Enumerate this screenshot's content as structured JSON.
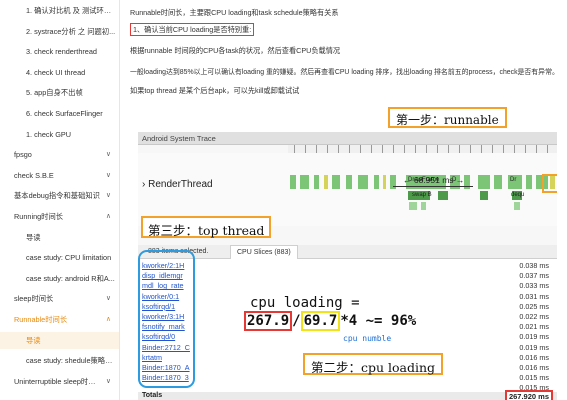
{
  "sidebar": {
    "items": [
      {
        "label": "1. 确认对比机 及 测试环境...",
        "indent": 2,
        "chevron": "",
        "state": "normal"
      },
      {
        "label": "2. systrace分析 之 问题初...",
        "indent": 2,
        "chevron": "",
        "state": "normal"
      },
      {
        "label": "3. check renderthread",
        "indent": 2,
        "chevron": "",
        "state": "normal"
      },
      {
        "label": "4. check UI thread",
        "indent": 2,
        "chevron": "",
        "state": "normal"
      },
      {
        "label": "5. app自身不出帧",
        "indent": 2,
        "chevron": "",
        "state": "normal"
      },
      {
        "label": "6. check SurfaceFlinger",
        "indent": 2,
        "chevron": "",
        "state": "normal"
      },
      {
        "label": "1. check GPU",
        "indent": 2,
        "chevron": "",
        "state": "normal"
      },
      {
        "label": "fpsgo",
        "indent": 0,
        "chevron": "∨",
        "state": "normal"
      },
      {
        "label": "check S.B.E",
        "indent": 0,
        "chevron": "∨",
        "state": "normal"
      },
      {
        "label": "基本debug指令和基础知识",
        "indent": 0,
        "chevron": "∨",
        "state": "normal"
      },
      {
        "label": "Running时间长",
        "indent": 0,
        "chevron": "∧",
        "state": "normal"
      },
      {
        "label": "导读",
        "indent": 1,
        "chevron": "",
        "state": "normal"
      },
      {
        "label": "case study: CPU limitation",
        "indent": 1,
        "chevron": "",
        "state": "normal"
      },
      {
        "label": "case study: android R和A...",
        "indent": 1,
        "chevron": "",
        "state": "normal"
      },
      {
        "label": "sleep时间长",
        "indent": 0,
        "chevron": "∨",
        "state": "normal"
      },
      {
        "label": "Runnable时间长",
        "indent": 0,
        "chevron": "∧",
        "state": "accent"
      },
      {
        "label": "导读",
        "indent": 1,
        "chevron": "",
        "state": "selected"
      },
      {
        "label": "case study: shedule策略导...",
        "indent": 1,
        "chevron": "",
        "state": "normal"
      },
      {
        "label": "Uninterruptible sleep时间长",
        "indent": 0,
        "chevron": "∨",
        "state": "normal"
      }
    ]
  },
  "article": {
    "line1": "Runnable时间长，主要跟CPU loading和task schedule策略有关系",
    "line2": "1、确认当前CPU loading是否特别重:",
    "line3": "根据runnable 时间段的CPU各task的状况，然后查看CPU负载情况",
    "line4": "一般loading达到85%以上可以确认有loading 重的嫌疑。然后再查看CPU loading 排序，找出loading 排名前五的process，check是否有异常。",
    "line5": "如果top thread 是某个后台apk，可以先kill或卸载试试"
  },
  "trace": {
    "title": "Android System Trace",
    "track_label": "› RenderThread",
    "measure": "← 68.951 ms →",
    "slice_labels": [
      "DrawFrame",
      "D",
      "Dr",
      "swap B",
      "dequ"
    ],
    "selection_text": "883 items selected.",
    "tab_label": "CPU Slices (883)",
    "threads": [
      "kworker/2:1H",
      "disp_idlemgr",
      "mdl_log_rate",
      "kworker/0:1",
      "ksoftirqd/1",
      "kworker/3:1H",
      "fsnotify_mark",
      "ksoftirqd/0",
      "Binder:2712_C",
      "krtatm",
      "Binder:1870_A",
      "Binder:1870_3"
    ],
    "times": [
      "0.038 ms",
      "0.037 ms",
      "0.033 ms",
      "0.031 ms",
      "0.025 ms",
      "0.022 ms",
      "0.021 ms",
      "0.019 ms",
      "0.019 ms",
      "0.016 ms",
      "0.016 ms",
      "0.015 ms",
      "0.015 ms"
    ],
    "totals_label": "Totals",
    "totals_value": "267.920 ms"
  },
  "annotations": {
    "step1": "第一步：runnable",
    "step2": "第二步：cpu loading",
    "step3": "第三步：top thread",
    "formula_title": "cpu loading =",
    "formula_v1": "267.9",
    "formula_v2": "69.7",
    "formula_rest": "*4 ~= 96%",
    "cpu_number": "cpu numble"
  },
  "colors": {
    "accent": "#e8890c",
    "highlight_red": "#e53935",
    "annotation_orange": "#f2a22a",
    "formula_yellow": "#f2e21a",
    "bracket_blue": "#2d9be0"
  }
}
